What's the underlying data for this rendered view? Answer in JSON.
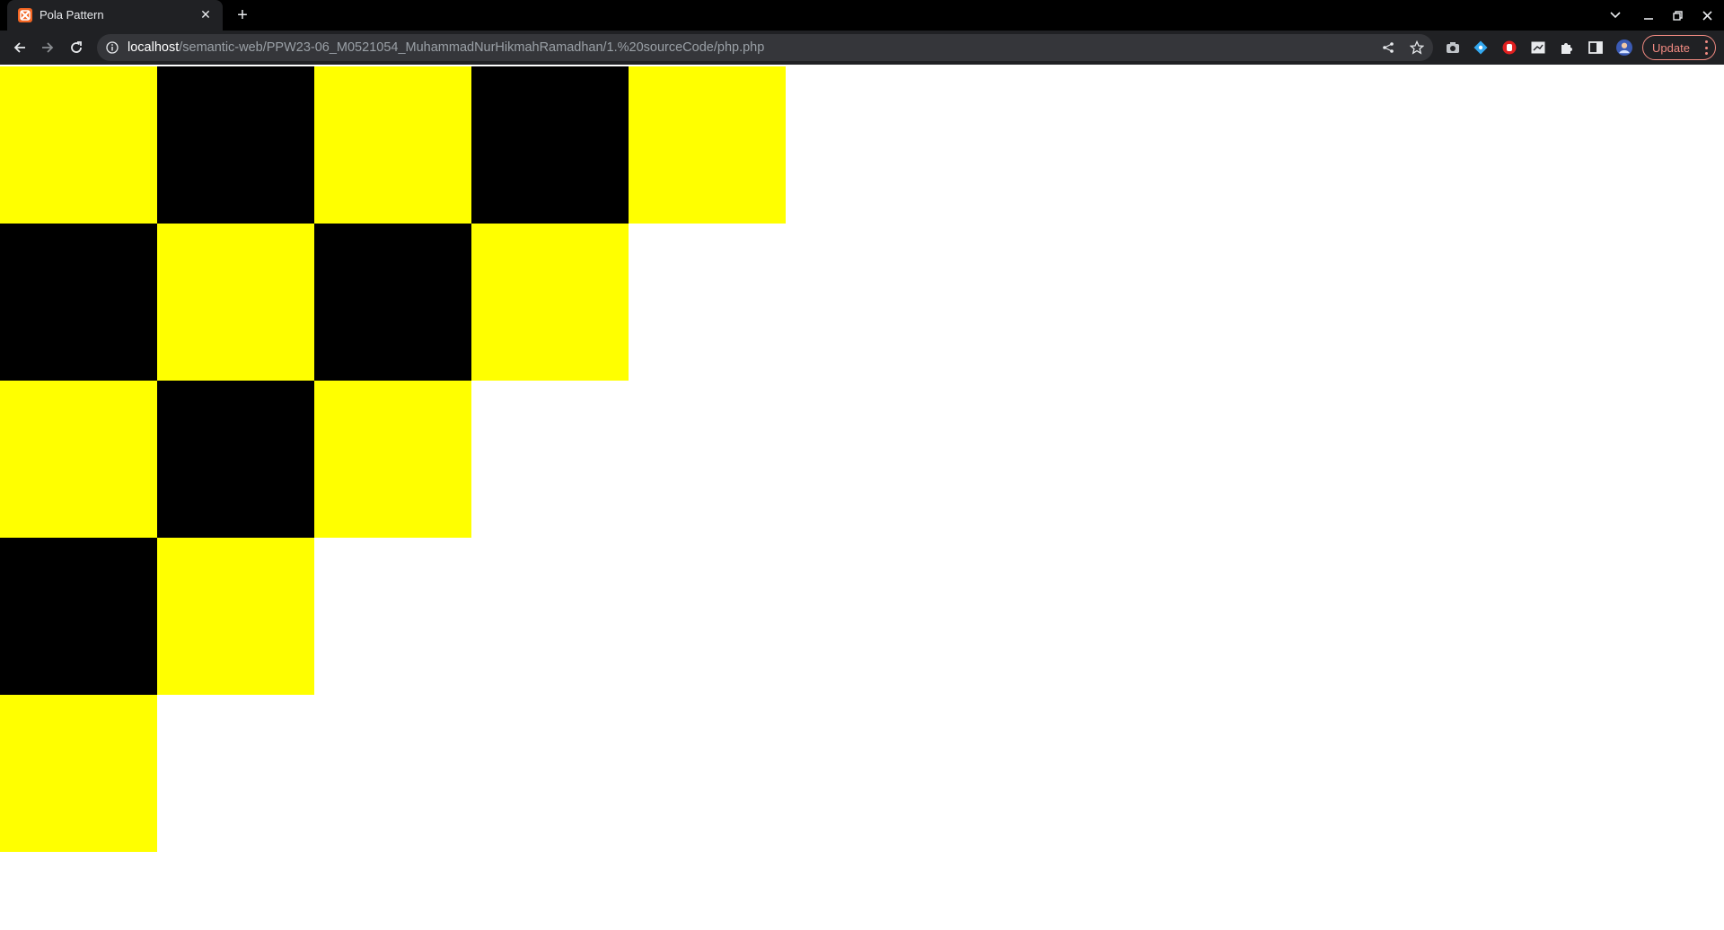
{
  "browser": {
    "tab": {
      "title": "Pola Pattern",
      "favicon": "xampp-icon"
    },
    "address_bar": {
      "host": "localhost",
      "path": "/semantic-web/PPW23-06_M0521054_MuhammadNurHikmahRamadhan/1.%20sourceCode/php.php"
    },
    "update_button": {
      "label": "Update"
    }
  },
  "pattern": {
    "colors": {
      "yellow": "#ffff00",
      "black": "#000000"
    },
    "rows": [
      [
        "yellow",
        "black",
        "yellow",
        "black",
        "yellow"
      ],
      [
        "black",
        "yellow",
        "black",
        "yellow"
      ],
      [
        "yellow",
        "black",
        "yellow"
      ],
      [
        "black",
        "yellow"
      ],
      [
        "yellow"
      ]
    ]
  }
}
